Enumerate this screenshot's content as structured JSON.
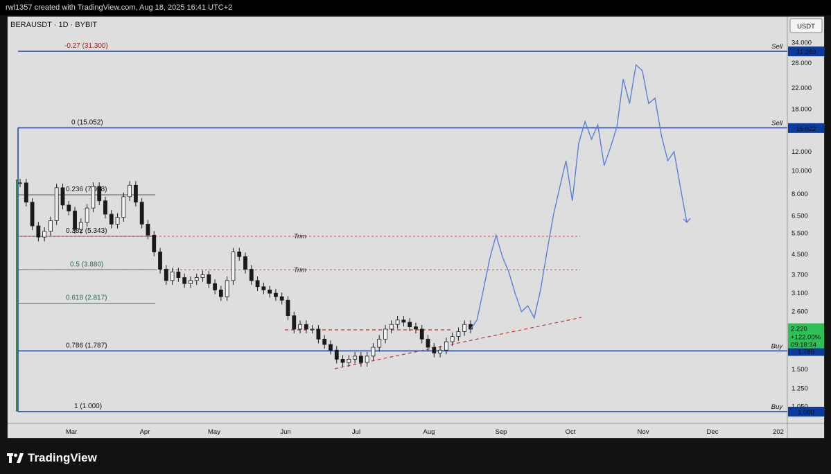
{
  "header": {
    "credit": "rwl1357 created with TradingView.com, Aug 18, 2025 16:41 UTC+2"
  },
  "symbol_line": "BERAUSDT · 1D · BYBIT",
  "currency": "USDT",
  "brand": "TradingView",
  "chart_data": {
    "type": "line",
    "yscale": "log",
    "ylim": [
      0.9,
      40
    ],
    "x_labels": [
      "Mar",
      "Apr",
      "May",
      "Jun",
      "Jul",
      "Aug",
      "Sep",
      "Oct",
      "Nov",
      "Dec",
      "202"
    ],
    "y_ticks": [
      "34.000",
      "28.000",
      "22.000",
      "18.000",
      "12.000",
      "10.000",
      "8.000",
      "6.500",
      "5.500",
      "4.500",
      "3.700",
      "3.100",
      "2.600",
      "1.500",
      "1.250",
      "1.050"
    ],
    "price_tags": [
      {
        "label": "31.263",
        "value": 31.263,
        "color": "#0b3a9e"
      },
      {
        "label": "15.022",
        "value": 15.022,
        "color": "#0b3a9e"
      },
      {
        "label": "1.785",
        "value": 1.785,
        "color": "#0b3a9e"
      },
      {
        "label": "1.000",
        "value": 1.0,
        "color": "#0b3a9e"
      }
    ],
    "last_price": {
      "label": "2.220",
      "change": "+122.00%",
      "countdown": "09:18:34",
      "value": 2.22,
      "color": "#2fbf56"
    },
    "fib_levels": [
      {
        "label": "-0.27 (31.300)",
        "value": 31.3,
        "color": "#9b1b1b"
      },
      {
        "label": "0 (15.052)",
        "value": 15.052,
        "color": "#111111"
      },
      {
        "label": "0.236 (7.938)",
        "value": 7.938,
        "color": "#111111"
      },
      {
        "label": "0.382 (5.343)",
        "value": 5.343,
        "color": "#111111"
      },
      {
        "label": "0.5 (3.880)",
        "value": 3.88,
        "color": "#2a6b50"
      },
      {
        "label": "0.618 (2.817)",
        "value": 2.817,
        "color": "#2a6b50"
      },
      {
        "label": "0.786 (1.787)",
        "value": 1.787,
        "color": "#111111"
      },
      {
        "label": "1 (1.000)",
        "value": 1.0,
        "color": "#111111"
      }
    ],
    "zones": [
      {
        "label": "Sell",
        "value": 31.3
      },
      {
        "label": "Sell",
        "value": 15.052
      },
      {
        "label": "Buy",
        "value": 1.787
      },
      {
        "label": "Buy",
        "value": 1.0
      }
    ],
    "trim_levels": [
      {
        "label": "Trim",
        "value": 5.343
      },
      {
        "label": "Trim",
        "value": 3.88
      }
    ],
    "price_series": [
      8.9,
      7.4,
      5.9,
      5.3,
      5.6,
      6.2,
      8.5,
      7.2,
      6.8,
      5.7,
      6.1,
      7.0,
      8.6,
      7.5,
      6.6,
      6.0,
      6.4,
      7.8,
      8.7,
      7.4,
      6.0,
      5.4,
      4.6,
      3.9,
      3.5,
      3.8,
      3.6,
      3.4,
      3.5,
      3.6,
      3.7,
      3.4,
      3.2,
      3.0,
      3.5,
      4.6,
      4.4,
      3.9,
      3.5,
      3.3,
      3.2,
      3.1,
      3.0,
      2.9,
      2.5,
      2.2,
      2.3,
      2.2,
      2.2,
      2.0,
      1.9,
      1.8,
      1.65,
      1.6,
      1.65,
      1.7,
      1.6,
      1.7,
      1.85,
      2.0,
      2.2,
      2.3,
      2.4,
      2.35,
      2.25,
      2.2,
      2.0,
      1.85,
      1.75,
      1.8,
      1.95,
      2.05,
      2.15,
      2.3,
      2.2
    ],
    "projection": [
      2.2,
      2.4,
      3.2,
      4.3,
      5.4,
      4.4,
      3.8,
      3.1,
      2.6,
      2.75,
      2.45,
      3.2,
      4.6,
      6.5,
      8.5,
      11.0,
      7.5,
      13.0,
      16.0,
      13.5,
      15.5,
      10.5,
      12.5,
      15.2,
      24.0,
      19.0,
      27.5,
      26.0,
      19.0,
      20.0,
      14.0,
      11.0,
      12.0,
      8.5,
      6.1
    ]
  }
}
